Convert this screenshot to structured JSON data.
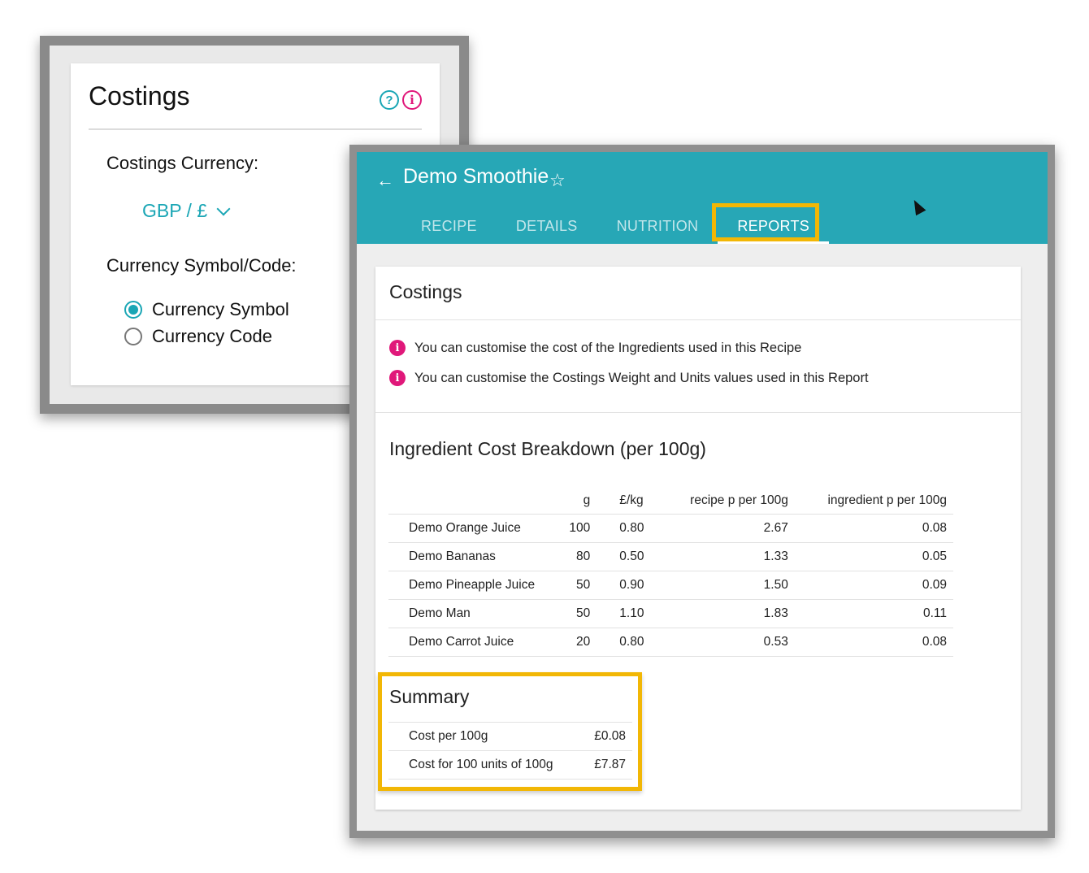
{
  "settings": {
    "title": "Costings",
    "help_glyph": "?",
    "info_glyph": "i",
    "currency_label": "Costings Currency:",
    "currency_value": "GBP / £",
    "symbol_code_label": "Currency Symbol/Code:",
    "options": [
      {
        "label": "Currency Symbol",
        "selected": true
      },
      {
        "label": "Currency Code",
        "selected": false
      }
    ]
  },
  "recipe": {
    "back_glyph": "←",
    "title": "Demo Smoothie",
    "star_glyph": "☆",
    "tabs": [
      {
        "label": "RECIPE",
        "active": false
      },
      {
        "label": "DETAILS",
        "active": false
      },
      {
        "label": "NUTRITION",
        "active": false
      },
      {
        "label": "REPORTS",
        "active": true
      }
    ]
  },
  "costings": {
    "title": "Costings",
    "info_glyph": "i",
    "notes": [
      "You can customise the cost of the Ingredients used in this Recipe",
      "You can customise the Costings Weight and Units values used in this Report"
    ],
    "breakdown_title": "Ingredient Cost Breakdown (per 100g)",
    "columns": [
      "",
      "g",
      "£/kg",
      "recipe p per 100g",
      "ingredient p per 100g"
    ],
    "rows": [
      {
        "name": "Demo Orange Juice",
        "g": "100",
        "kg": "0.80",
        "recipe_p": "2.67",
        "ingredient_p": "0.08"
      },
      {
        "name": "Demo Bananas",
        "g": "80",
        "kg": "0.50",
        "recipe_p": "1.33",
        "ingredient_p": "0.05"
      },
      {
        "name": "Demo Pineapple Juice",
        "g": "50",
        "kg": "0.90",
        "recipe_p": "1.50",
        "ingredient_p": "0.09"
      },
      {
        "name": "Demo Man",
        "g": "50",
        "kg": "1.10",
        "recipe_p": "1.83",
        "ingredient_p": "0.11"
      },
      {
        "name": "Demo Carrot Juice",
        "g": "20",
        "kg": "0.80",
        "recipe_p": "0.53",
        "ingredient_p": "0.08"
      }
    ],
    "summary_title": "Summary",
    "summary": [
      {
        "label": "Cost per 100g",
        "value": "£0.08"
      },
      {
        "label": "Cost for 100 units of 100g",
        "value": "£7.87"
      }
    ]
  },
  "colors": {
    "accent": "#27a7b6",
    "info": "#e0187a",
    "highlight": "#f2b705"
  }
}
